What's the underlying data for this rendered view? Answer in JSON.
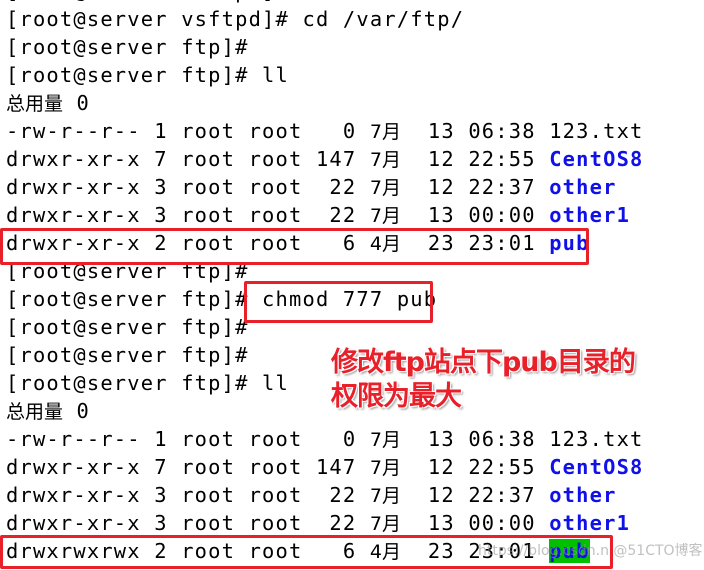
{
  "terminal": {
    "lines": [
      {
        "prompt": "[root@server vsftpd]#",
        "cmd": ""
      },
      {
        "prompt": "[root@server vsftpd]#",
        "cmd": " cd /var/ftp/"
      },
      {
        "prompt": "[root@server ftp]#",
        "cmd": ""
      },
      {
        "prompt": "[root@server ftp]#",
        "cmd": " ll"
      },
      {
        "text": "总用量 0"
      },
      {
        "perm": "-rw-r--r--",
        "links": "1",
        "owner": "root",
        "group": "root",
        "size": "  0",
        "month": "7月",
        "day": "13",
        "time": "06:38",
        "name": "123.txt",
        "is_dir": false
      },
      {
        "perm": "drwxr-xr-x",
        "links": "7",
        "owner": "root",
        "group": "root",
        "size": "147",
        "month": "7月",
        "day": "12",
        "time": "22:55",
        "name": "CentOS8",
        "is_dir": true
      },
      {
        "perm": "drwxr-xr-x",
        "links": "3",
        "owner": "root",
        "group": "root",
        "size": " 22",
        "month": "7月",
        "day": "12",
        "time": "22:37",
        "name": "other",
        "is_dir": true
      },
      {
        "perm": "drwxr-xr-x",
        "links": "3",
        "owner": "root",
        "group": "root",
        "size": " 22",
        "month": "7月",
        "day": "13",
        "time": "00:00",
        "name": "other1",
        "is_dir": true
      },
      {
        "perm": "drwxr-xr-x",
        "links": "2",
        "owner": "root",
        "group": "root",
        "size": "  6",
        "month": "4月",
        "day": "23",
        "time": "23:01",
        "name": "pub",
        "is_dir": true
      },
      {
        "prompt": "[root@server ftp]#",
        "cmd": ""
      },
      {
        "prompt": "[root@server ftp]#",
        "cmd": " chmod 777 pub"
      },
      {
        "prompt": "[root@server ftp]#",
        "cmd": ""
      },
      {
        "prompt": "[root@server ftp]#",
        "cmd": ""
      },
      {
        "prompt": "[root@server ftp]#",
        "cmd": " ll"
      },
      {
        "text": "总用量 0"
      },
      {
        "perm": "-rw-r--r--",
        "links": "1",
        "owner": "root",
        "group": "root",
        "size": "  0",
        "month": "7月",
        "day": "13",
        "time": "06:38",
        "name": "123.txt",
        "is_dir": false
      },
      {
        "perm": "drwxr-xr-x",
        "links": "7",
        "owner": "root",
        "group": "root",
        "size": "147",
        "month": "7月",
        "day": "12",
        "time": "22:55",
        "name": "CentOS8",
        "is_dir": true
      },
      {
        "perm": "drwxr-xr-x",
        "links": "3",
        "owner": "root",
        "group": "root",
        "size": " 22",
        "month": "7月",
        "day": "12",
        "time": "22:37",
        "name": "other",
        "is_dir": true
      },
      {
        "perm": "drwxr-xr-x",
        "links": "3",
        "owner": "root",
        "group": "root",
        "size": " 22",
        "month": "7月",
        "day": "13",
        "time": "00:00",
        "name": "other1",
        "is_dir": true
      },
      {
        "perm": "drwxrwxrwx",
        "links": "2",
        "owner": "root",
        "group": "root",
        "size": "  6",
        "month": "4月",
        "day": "23",
        "time": "23:01",
        "name": "pub",
        "is_dir": true,
        "highlight": true
      }
    ]
  },
  "annotation": {
    "line1": "修改ftp站点下pub目录的",
    "line2": "权限为最大"
  },
  "watermark": "https://blog.csdn.n @51CTO博客",
  "colors": {
    "directory": "#1010e8",
    "highlight": "#00c000",
    "box": "#e8202a"
  }
}
